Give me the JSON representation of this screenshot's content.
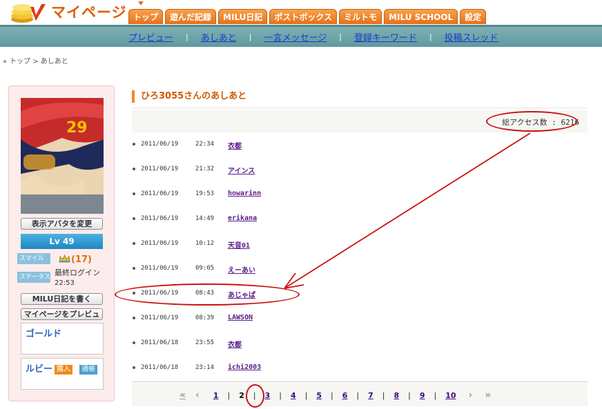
{
  "header": {
    "logo_text": "マイページ",
    "tabs": [
      "トップ",
      "遊んだ記録",
      "MILU日記",
      "ポストボックス",
      "ミルトモ",
      "MILU SCHOOL",
      "設定"
    ]
  },
  "subnav": {
    "links": [
      "プレビュー",
      "あしあと",
      "一言メッセージ",
      "登録キーワード",
      "投稿スレッド"
    ]
  },
  "breadcrumb": {
    "top": "トップ",
    "separator": ">",
    "current": "あしあと"
  },
  "sidebar": {
    "change_avatar_button": "表示アバタを変更",
    "level": "Lv 49",
    "smile_label": "スマイル",
    "smile_count": "(17)",
    "status_label": "ステータス",
    "login_label": "最終ログイン",
    "login_time": "22:53",
    "write_diary_button": "MILU日記を書く",
    "preview_button": "マイページをプレビュー",
    "gold_label": "ゴールド",
    "ruby_label": "ルビー",
    "buy_tag": "購入",
    "history_tag": "通帳"
  },
  "main": {
    "title": "ひろ3055さんのあしあと",
    "access_count": "総アクセス数 : 6216",
    "visits": [
      {
        "date": "2011/06/19",
        "time": "22:34",
        "name": "衣都"
      },
      {
        "date": "2011/06/19",
        "time": "21:32",
        "name": "アインス"
      },
      {
        "date": "2011/06/19",
        "time": "19:53",
        "name": "howarinn"
      },
      {
        "date": "2011/06/19",
        "time": "14:49",
        "name": "erikana"
      },
      {
        "date": "2011/06/19",
        "time": "10:12",
        "name": "天音01"
      },
      {
        "date": "2011/06/19",
        "time": "09:05",
        "name": "えーあい"
      },
      {
        "date": "2011/06/19",
        "time": "08:43",
        "name": "あじゃぱ"
      },
      {
        "date": "2011/06/19",
        "time": "08:39",
        "name": "LAWSON"
      },
      {
        "date": "2011/06/18",
        "time": "23:55",
        "name": "衣都"
      },
      {
        "date": "2011/06/18",
        "time": "23:14",
        "name": "ichi2003"
      }
    ]
  },
  "pager": {
    "first": "«",
    "prev": "‹",
    "pages": [
      "1",
      "2",
      "3",
      "4",
      "5",
      "6",
      "7",
      "8",
      "9",
      "10"
    ],
    "current": "2",
    "next": "›",
    "last": "»"
  },
  "colors": {
    "accent_orange": "#e5701a",
    "subnav_teal": "#6aa5aa",
    "annotation_red": "#cc1111",
    "link_blue": "#1a3cc8"
  }
}
